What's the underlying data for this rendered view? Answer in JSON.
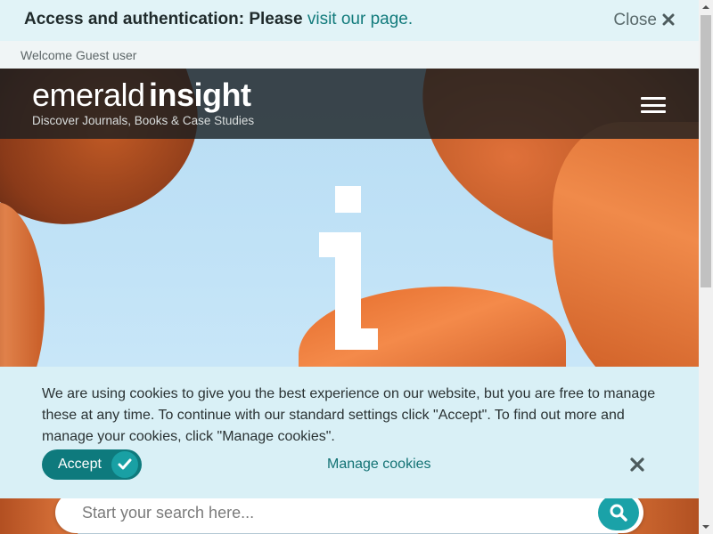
{
  "access_banner": {
    "prefix": "Access and authentication: Please",
    "link_label": "visit our page.",
    "close_label": "Close",
    "close_icon": "close-icon"
  },
  "welcome": {
    "text": "Welcome Guest user"
  },
  "header": {
    "logo_light": "emerald",
    "logo_bold": "insight",
    "tagline": "Discover Journals, Books & Case Studies",
    "menu_icon": "hamburger-menu-icon"
  },
  "hero": {
    "logo_mark": "i-logo-icon"
  },
  "search": {
    "placeholder": "Start your search here...",
    "button_icon": "search-icon"
  },
  "cookie_banner": {
    "text": "We are using cookies to give you the best experience on our website, but you are free to manage these at any time. To continue with our standard settings click \"Accept\". To find out more and manage your cookies, click \"Manage cookies\".",
    "accept_label": "Accept",
    "accept_icon": "checkmark-icon",
    "manage_label": "Manage cookies",
    "close_icon": "close-icon"
  },
  "colors": {
    "teal_accent": "#1aa2a8",
    "teal_dark": "#0e7a7d",
    "link": "#127b7c",
    "banner_bg": "#e1f3f7",
    "cookie_bg": "#d9f0f6"
  }
}
